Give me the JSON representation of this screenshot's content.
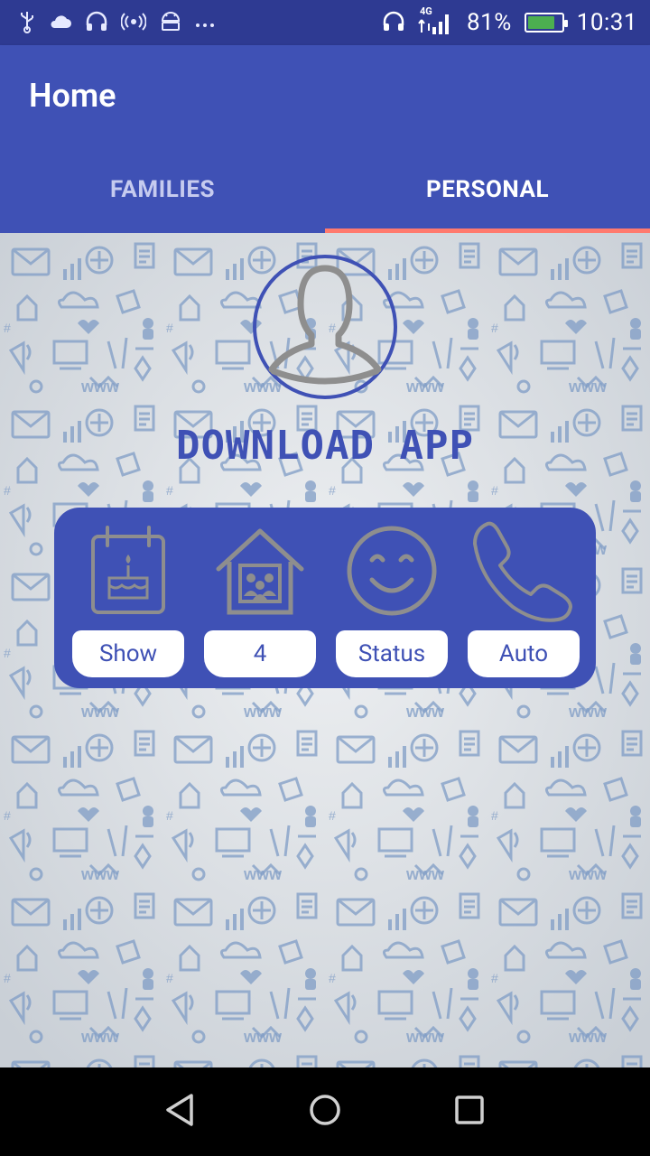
{
  "status_bar": {
    "left_icons": [
      "usb-icon",
      "cloud-icon",
      "headset-icon",
      "hotspot-icon",
      "android-icon",
      "more-icon"
    ],
    "network_label": "4G",
    "battery_percent_text": "81%",
    "battery_level": 0.81,
    "time": "10:31"
  },
  "appbar": {
    "title": "Home"
  },
  "tabs": [
    {
      "label": "FAMILIES",
      "active": false
    },
    {
      "label": "PERSONAL",
      "active": true
    }
  ],
  "profile": {
    "avatar_icon": "person-icon",
    "download_text": "DOWNLOAD APP"
  },
  "features": [
    {
      "icon": "birthday-calendar-icon",
      "label": "Show"
    },
    {
      "icon": "family-home-icon",
      "label": "4"
    },
    {
      "icon": "smiley-icon",
      "label": "Status"
    },
    {
      "icon": "phone-icon",
      "label": "Auto"
    }
  ],
  "navbar": {
    "icons": [
      "back-icon",
      "home-icon",
      "recents-icon"
    ]
  },
  "colors": {
    "primary": "#3f51b5",
    "status_bar": "#2e3a92",
    "tab_indicator": "#ff7a6e",
    "icon_gray": "#8e8e8e"
  }
}
